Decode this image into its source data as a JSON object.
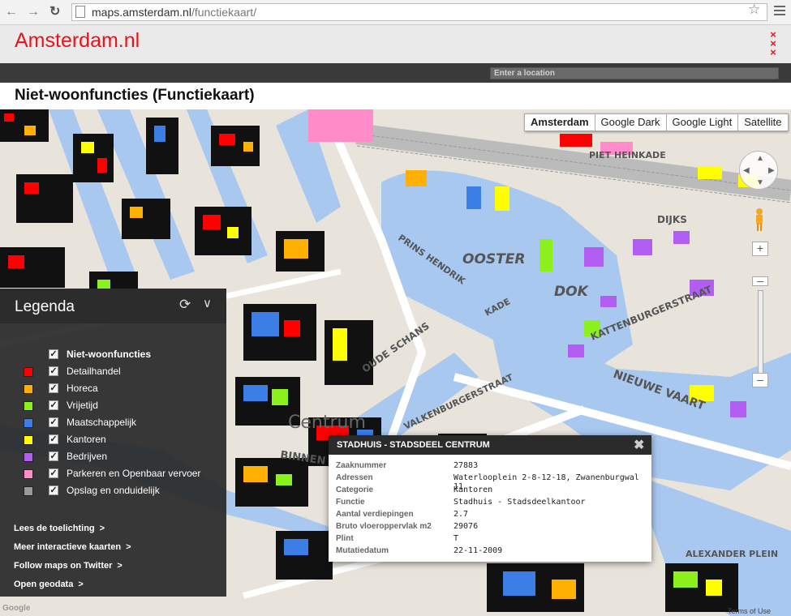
{
  "browser": {
    "back_icon": "arrow-left-icon",
    "forward_icon": "arrow-right-icon",
    "reload_icon": "reload-icon",
    "url_host": "maps.amsterdam.nl",
    "url_path": "/functiekaart/",
    "bookmark_icon": "star-icon",
    "menu_icon": "hamburger-icon"
  },
  "header": {
    "logo": "Amsterdam.nl",
    "location_placeholder": "Enter a location"
  },
  "page_title": "Niet-woonfuncties (Functiekaart)",
  "map_types": [
    {
      "label": "Amsterdam",
      "active": true
    },
    {
      "label": "Google Dark",
      "active": false
    },
    {
      "label": "Google Light",
      "active": false
    },
    {
      "label": "Satellite",
      "active": false
    }
  ],
  "map_labels": {
    "oosterdok_1": "OOSTER",
    "oosterdok_2": "DOK",
    "prins_hendrik": "PRINS HENDRIK",
    "piet_heinkade": "PIET HEINKADE",
    "dijks": "DIJKS",
    "kattenburgerstraat": "KATTENBURGERSTRAAT",
    "nieuwe_vaart": "NIEUWE VAART",
    "oude_schans": "OUDE SCHANS",
    "valkenburgerstraat": "VALKENBURGERSTRAAT",
    "centrum": "Centrum",
    "binnen": "BINNEN",
    "kade": "KADE",
    "alexander_plein": "ALEXANDER PLEIN"
  },
  "legend": {
    "title": "Legenda",
    "refresh_icon": "refresh-icon",
    "collapse_icon": "chevron-down-icon",
    "group_label": "Niet-woonfuncties",
    "items": [
      {
        "label": "Detailhandel",
        "color": "#ff0000"
      },
      {
        "label": "Horeca",
        "color": "#ffb000"
      },
      {
        "label": "Vrijetijd",
        "color": "#8cf01c"
      },
      {
        "label": "Maatschappelijk",
        "color": "#3a7ee6"
      },
      {
        "label": "Kantoren",
        "color": "#ffff00"
      },
      {
        "label": "Bedrijven",
        "color": "#b25ef2"
      },
      {
        "label": "Parkeren en Openbaar vervoer",
        "color": "#ff8cc8"
      },
      {
        "label": "Opslag en onduidelijk",
        "color": "#9a9a9a"
      }
    ],
    "links": [
      "Lees de toelichting",
      "Meer interactieve kaarten",
      "Follow maps on Twitter",
      "Open geodata"
    ]
  },
  "popup": {
    "title": "STADHUIS - STADSDEEL CENTRUM",
    "close_icon": "close-icon",
    "rows": [
      {
        "key": "Zaaknummer",
        "value": "27883"
      },
      {
        "key": "Adressen",
        "value": "Waterlooplein 2-8-12-18, Zwanenburgwal 11"
      },
      {
        "key": "Categorie",
        "value": "Kantoren"
      },
      {
        "key": "Functie",
        "value": "Stadhuis - Stadsdeelkantoor"
      },
      {
        "key": "Aantal verdiepingen",
        "value": "2.7"
      },
      {
        "key": "Bruto vloeroppervlak m2",
        "value": "29076"
      },
      {
        "key": "Plint",
        "value": "T"
      },
      {
        "key": "Mutatiedatum",
        "value": "22-11-2009"
      }
    ]
  },
  "map_footer": {
    "google_credit": "Google",
    "terms": "Terms of Use"
  }
}
